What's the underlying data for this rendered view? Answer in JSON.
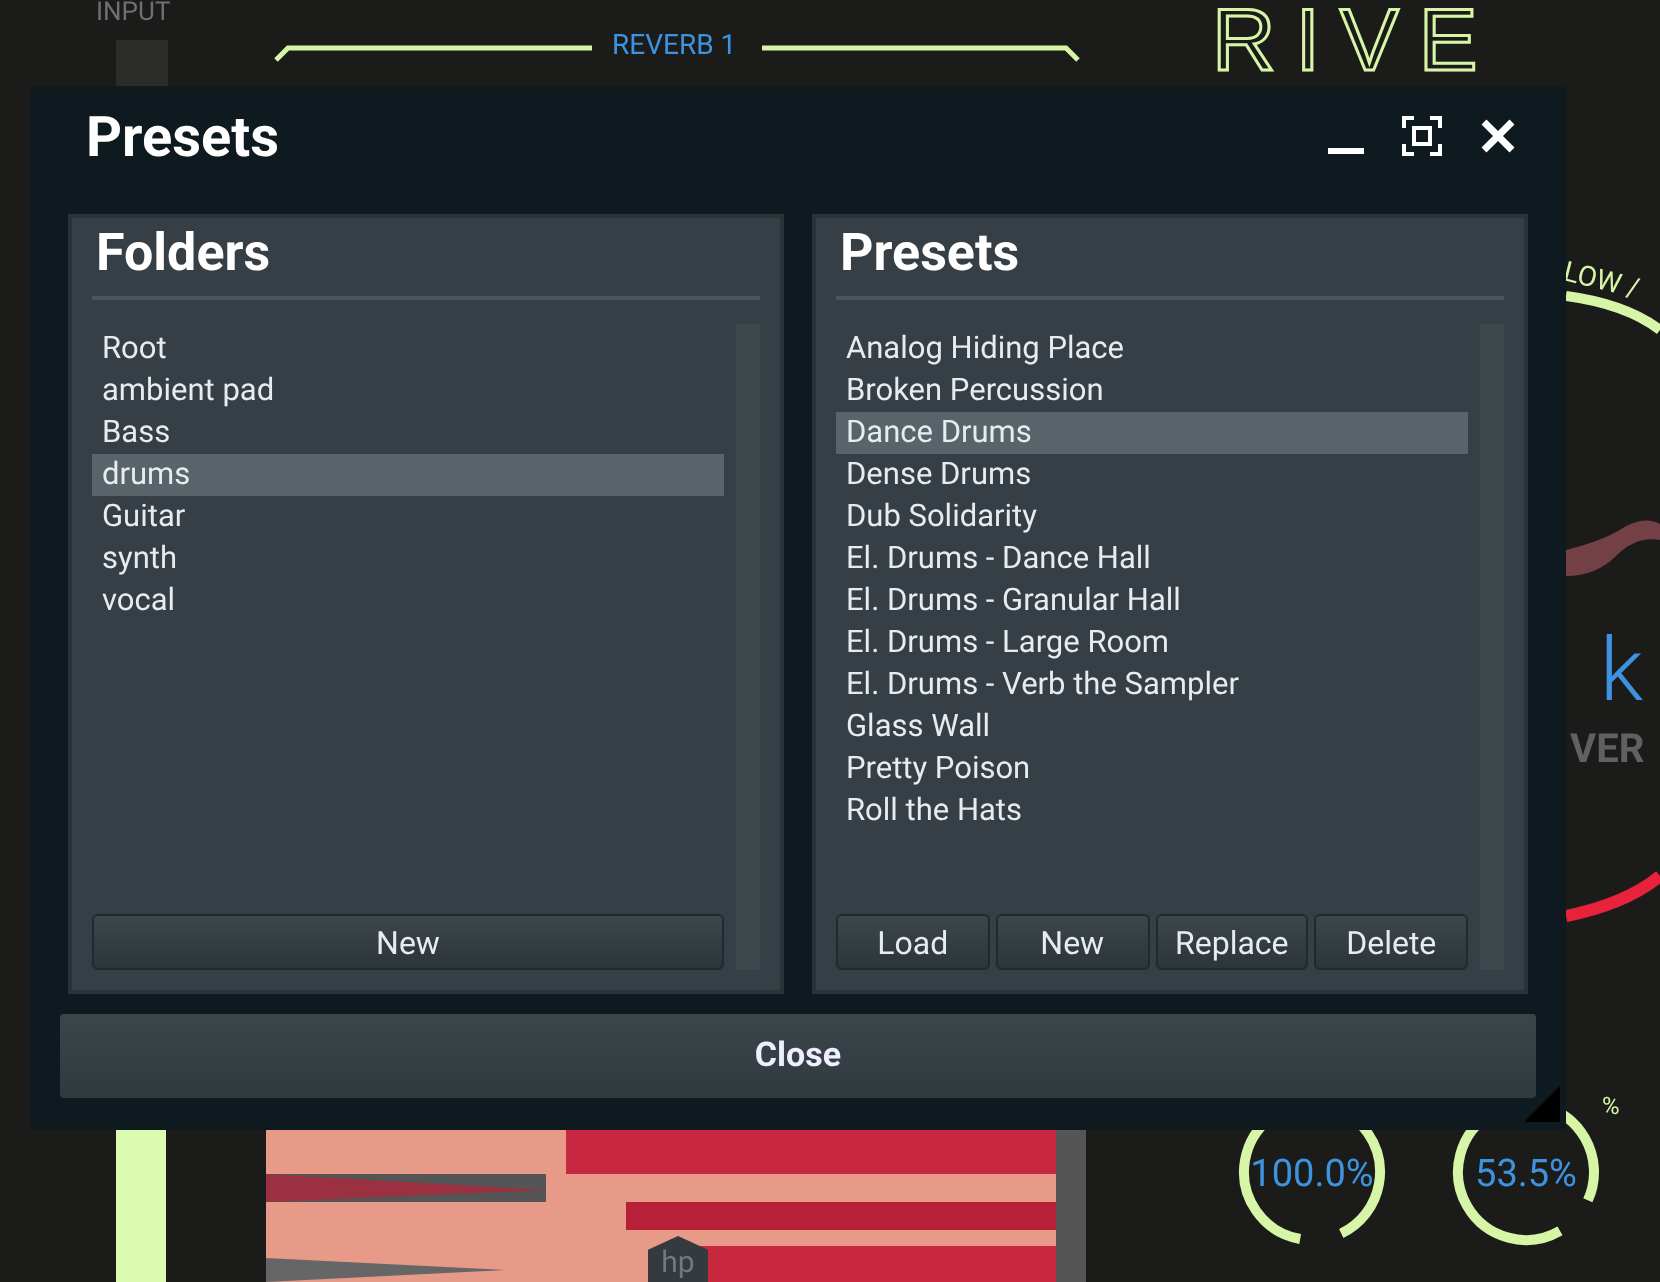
{
  "background": {
    "input_label": "INPUT",
    "section_title": "REVERB 1",
    "logo": "RIVE",
    "arc_label": "LOW /",
    "value_letter": "k",
    "caption": "VER",
    "marker": "hp",
    "unit": "%",
    "knobs": [
      {
        "reading": "100.0%"
      },
      {
        "reading": "53.5%"
      }
    ]
  },
  "dialog": {
    "title": "Presets",
    "folders": {
      "title": "Folders",
      "items": [
        {
          "label": "Root",
          "selected": false
        },
        {
          "label": "ambient pad",
          "selected": false
        },
        {
          "label": "Bass",
          "selected": false
        },
        {
          "label": "drums",
          "selected": true
        },
        {
          "label": "Guitar",
          "selected": false
        },
        {
          "label": "synth",
          "selected": false
        },
        {
          "label": "vocal",
          "selected": false
        }
      ],
      "buttons": [
        "New"
      ]
    },
    "presets": {
      "title": "Presets",
      "items": [
        {
          "label": "Analog Hiding Place",
          "selected": false
        },
        {
          "label": "Broken Percussion",
          "selected": false
        },
        {
          "label": "Dance Drums",
          "selected": true
        },
        {
          "label": "Dense Drums",
          "selected": false
        },
        {
          "label": "Dub Solidarity",
          "selected": false
        },
        {
          "label": "El. Drums - Dance Hall",
          "selected": false
        },
        {
          "label": "El. Drums - Granular Hall",
          "selected": false
        },
        {
          "label": "El. Drums - Large Room",
          "selected": false
        },
        {
          "label": "El. Drums - Verb the Sampler",
          "selected": false
        },
        {
          "label": "Glass Wall",
          "selected": false
        },
        {
          "label": "Pretty Poison",
          "selected": false
        },
        {
          "label": "Roll the Hats",
          "selected": false
        }
      ],
      "buttons": [
        "Load",
        "New",
        "Replace",
        "Delete"
      ]
    },
    "close_button": "Close"
  }
}
